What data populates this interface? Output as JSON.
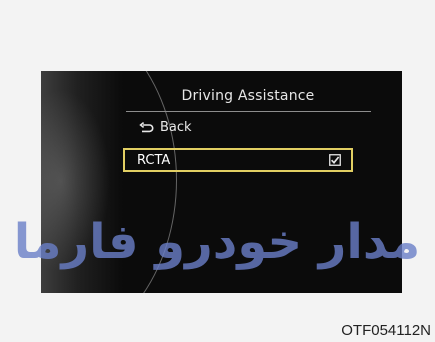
{
  "screen": {
    "title": "Driving Assistance",
    "back": {
      "icon": "return-arrow-icon",
      "label": "Back"
    },
    "options": [
      {
        "label": "RCTA",
        "checked": true,
        "selected": true,
        "icon": "checkbox-checked-icon"
      }
    ]
  },
  "watermark": {
    "text": "مدار خودرو فارما",
    "color": "#6a7fc8"
  },
  "figure": {
    "reference_code": "OTF054112N"
  },
  "colors": {
    "screen_background": "#0b0b0b",
    "highlight_border": "#e2cf63",
    "text": "#e8e8e8"
  }
}
